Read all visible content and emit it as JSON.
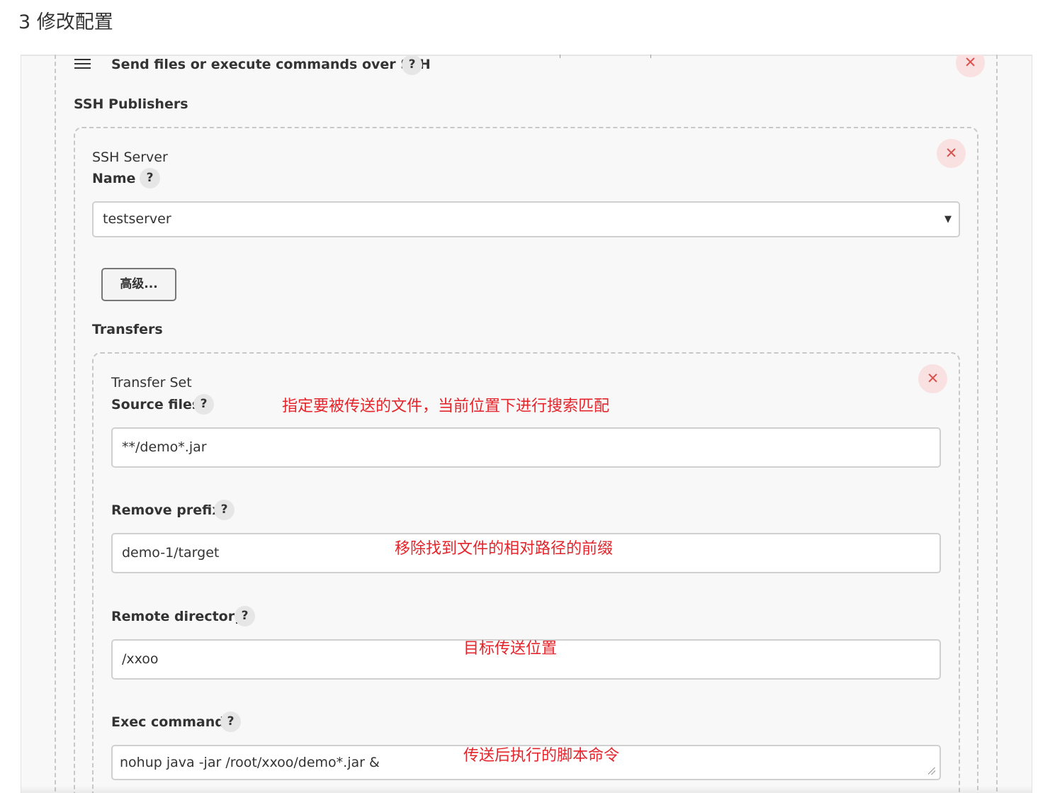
{
  "article": {
    "heading": "3 修改配置"
  },
  "step": {
    "title": "Send files or execute commands over SSH",
    "help_icon": "question-mark",
    "delete_icon": "close-x"
  },
  "ssh_publishers": {
    "label": "SSH Publishers",
    "server": {
      "section_label": "SSH Server",
      "name_label": "Name",
      "name_value": "testserver",
      "advanced_button": "高级...",
      "transfers_label": "Transfers"
    }
  },
  "transfer_set": {
    "section_label": "Transfer Set",
    "source_files": {
      "label": "Source files",
      "value": "**/demo*.jar",
      "annotation": "指定要被传送的文件，当前位置下进行搜索匹配"
    },
    "remove_prefix": {
      "label": "Remove prefix",
      "value": "demo-1/target",
      "annotation": "移除找到文件的相对路径的前缀"
    },
    "remote_directory": {
      "label": "Remote directory",
      "value": "/xxoo",
      "annotation": "目标传送位置"
    },
    "exec_command": {
      "label": "Exec command",
      "value": "nohup java -jar /root/xxoo/demo*.jar &",
      "annotation": "传送后执行的脚本命令"
    }
  },
  "colors": {
    "annotation": "#e4252b",
    "delete_bg": "#f9e1e1",
    "delete_fg": "#d9534f",
    "panel_bg": "#f8f8f8"
  }
}
